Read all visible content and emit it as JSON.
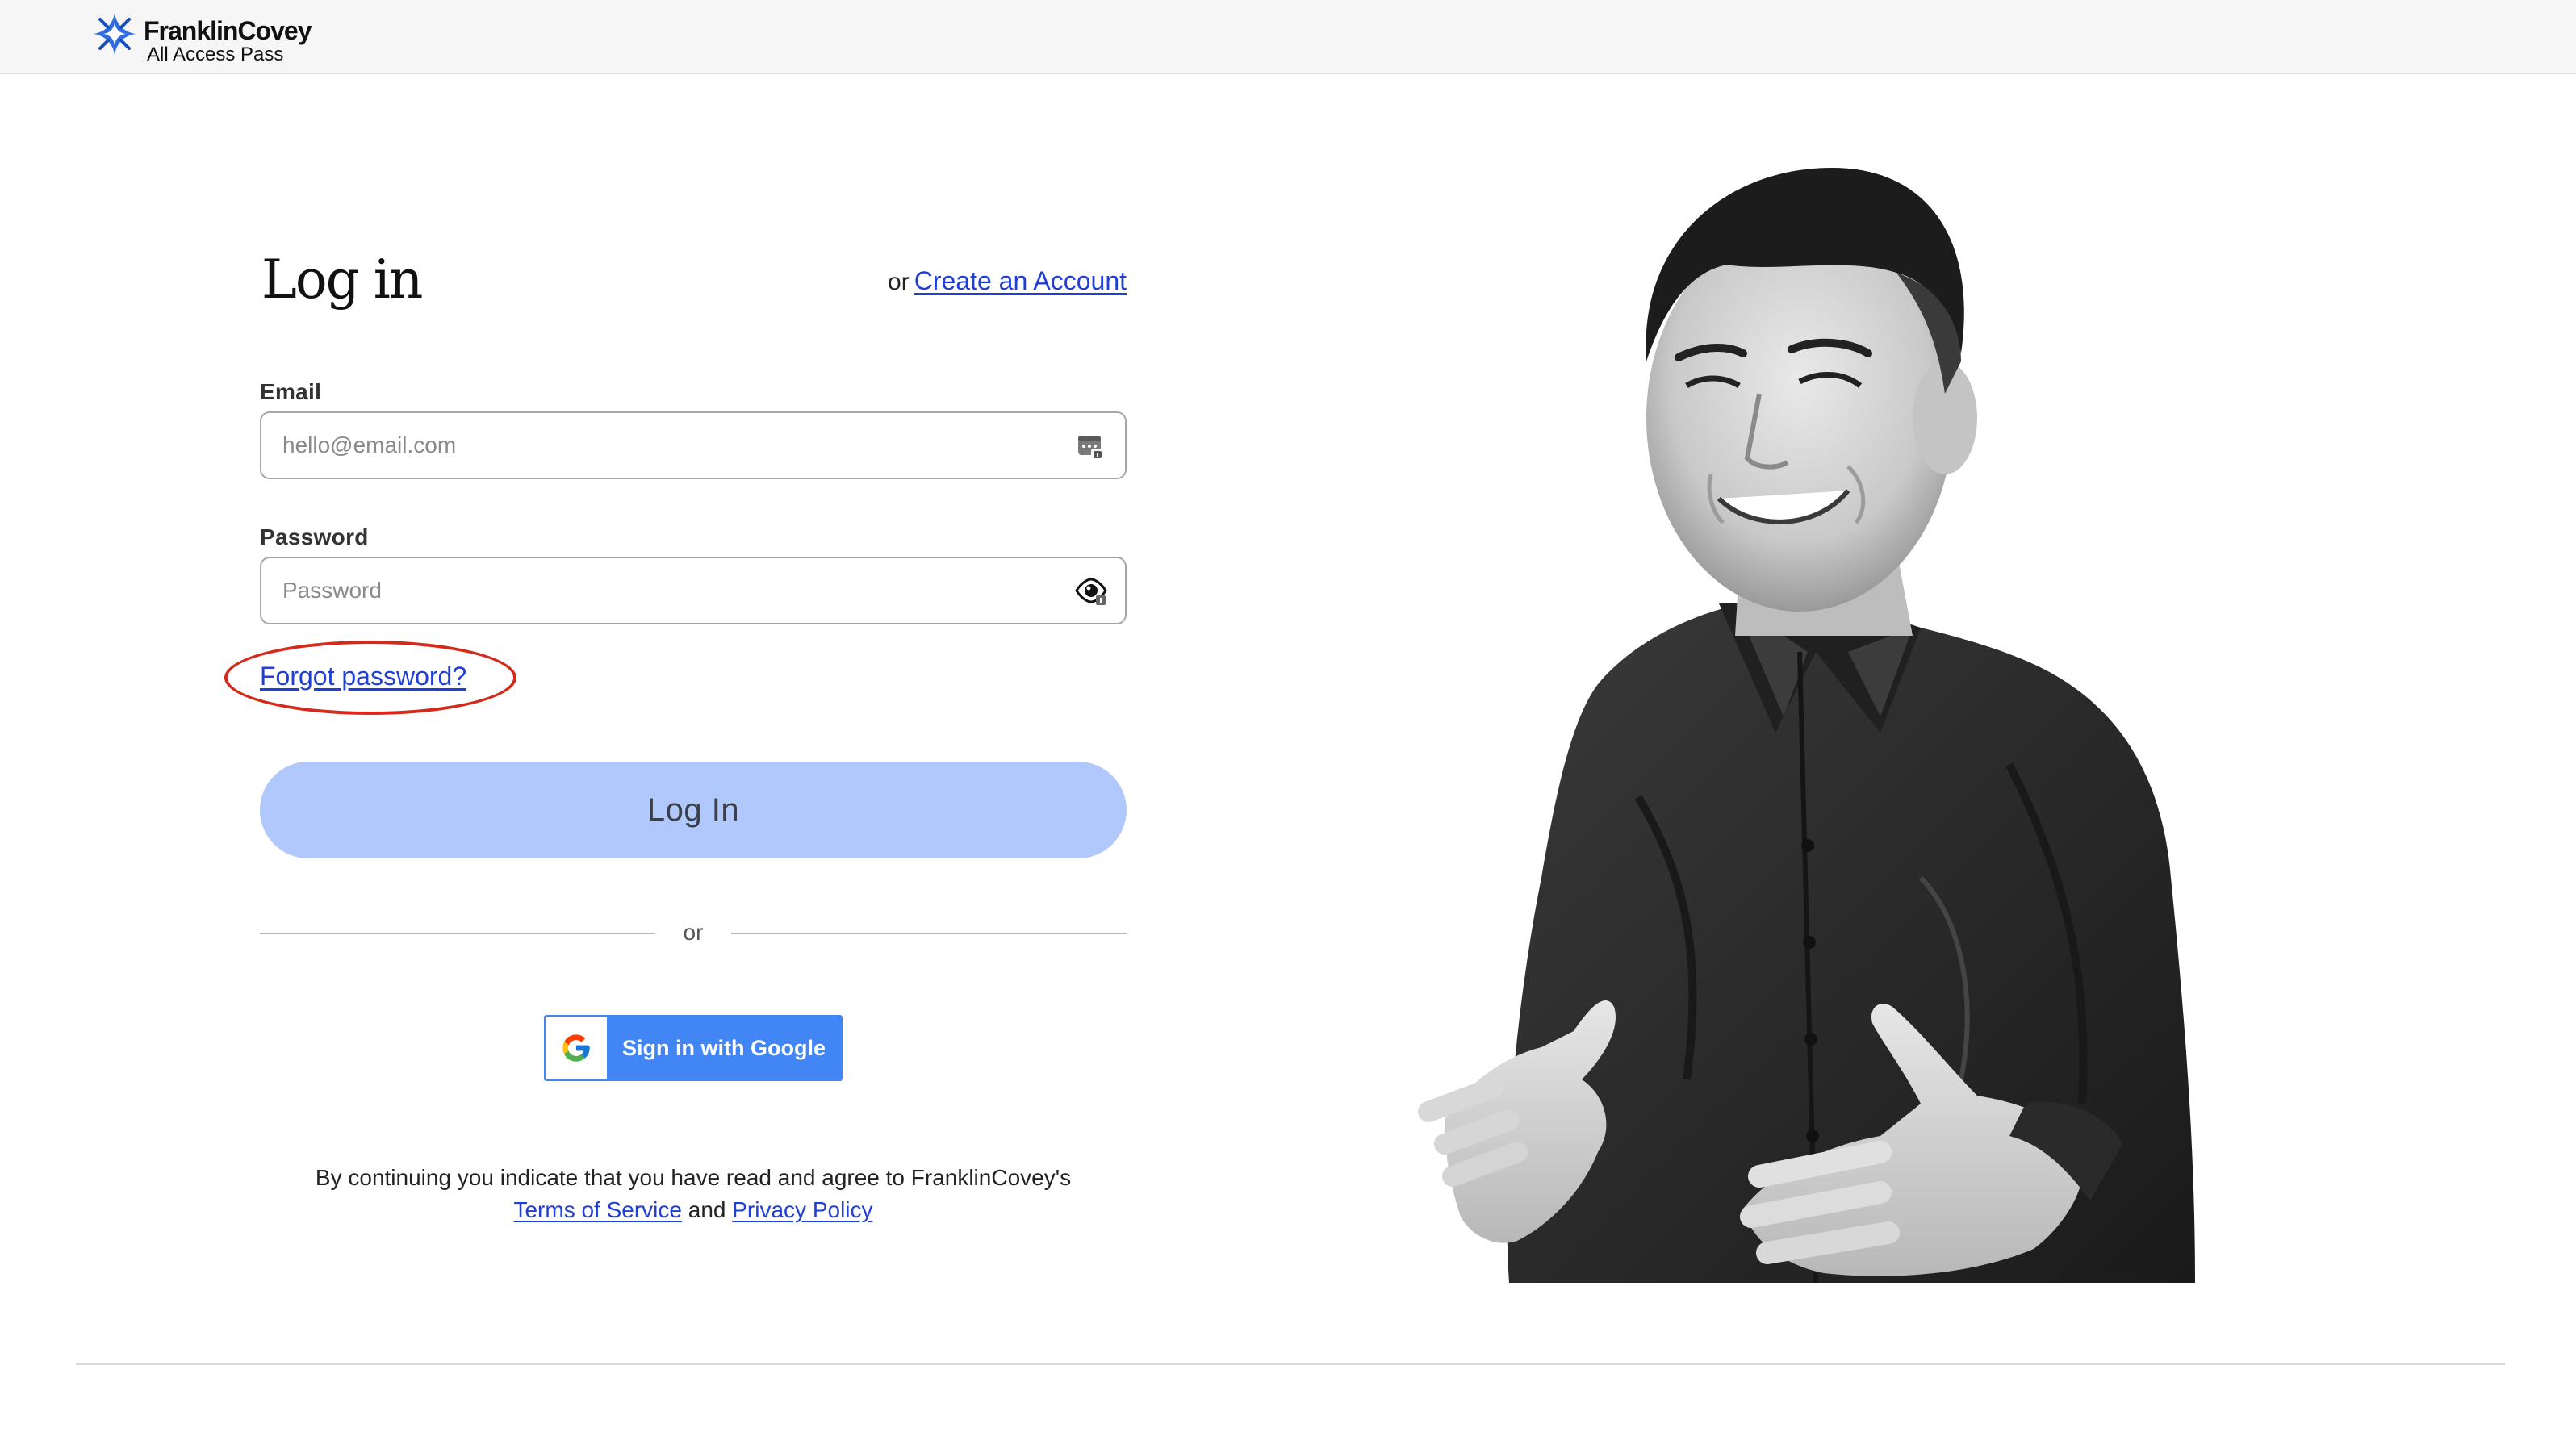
{
  "brand": {
    "name": "FranklinCovey",
    "subtitle": "All Access Pass",
    "accent_color": "#2f6de1"
  },
  "login": {
    "title": "Log in",
    "create_prefix": "or",
    "create_link": "Create an Account",
    "email": {
      "label": "Email",
      "placeholder": "hello@email.com",
      "value": "",
      "icon": "password-manager-icon"
    },
    "password": {
      "label": "Password",
      "placeholder": "Password",
      "value": "",
      "icon": "show-password-eye-icon"
    },
    "forgot_link": "Forgot password?",
    "submit_label": "Log In",
    "submit_color": "#b0c8fb",
    "divider_text": "or",
    "google_label": "Sign in with Google",
    "google_color": "#4285f4",
    "terms_text": "By continuing you indicate that you have read and agree to FranklinCovey's",
    "terms_link": "Terms of Service",
    "terms_and": "and",
    "privacy_link": "Privacy Policy",
    "annotation_color": "#d42a1c"
  },
  "hero": {
    "image": "portrait-photo"
  }
}
